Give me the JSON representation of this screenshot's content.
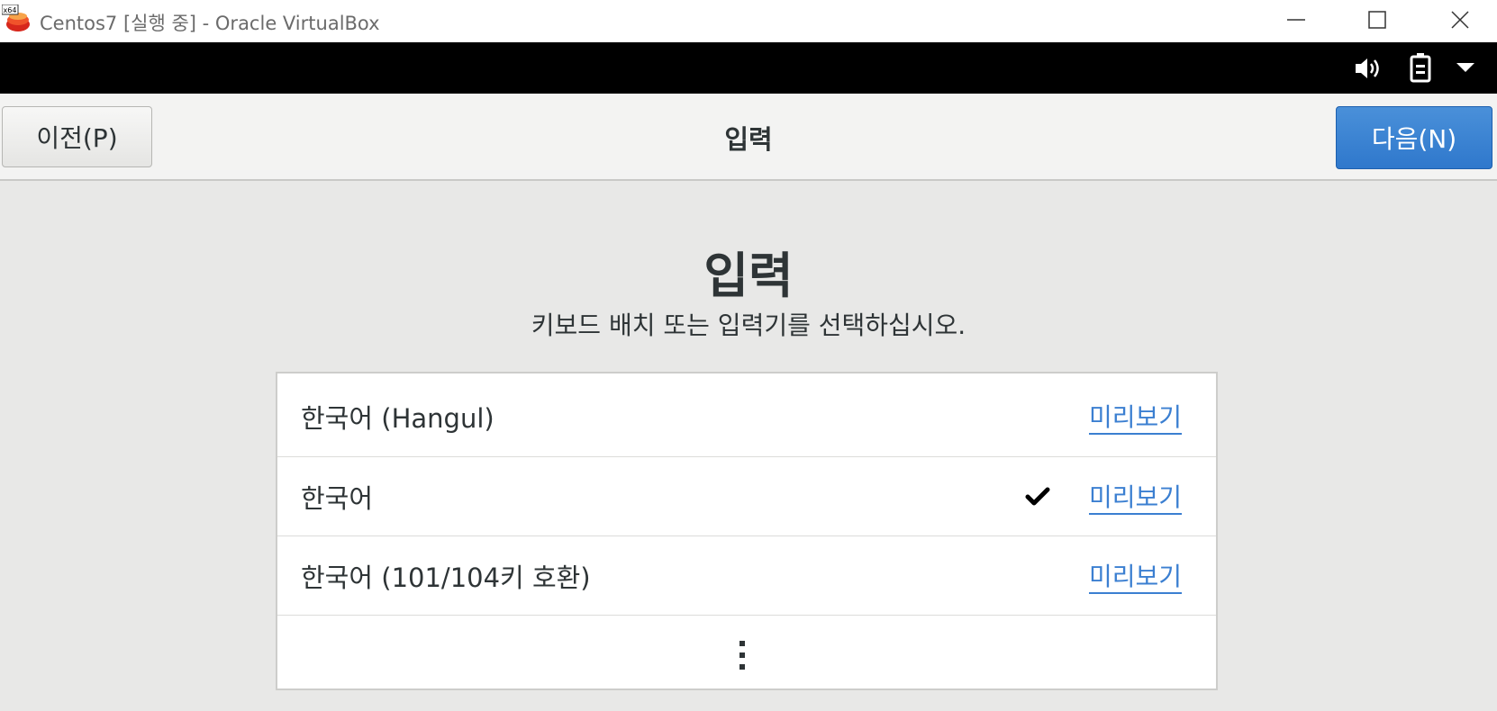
{
  "window": {
    "title": "Centos7 [실행 중] - Oracle VirtualBox",
    "icon": "virtualbox-x64-icon",
    "controls": [
      "minimize-icon",
      "maximize-icon",
      "close-icon"
    ]
  },
  "top_bar": {
    "icons": [
      "volume-icon",
      "battery-icon",
      "dropdown-arrow-icon"
    ]
  },
  "header": {
    "prev_label": "이전(P)",
    "title": "입력",
    "next_label": "다음(N)",
    "next_color": "#3584e4"
  },
  "main": {
    "title": "입력",
    "subtitle": "키보드 배치 또는 입력기를 선택하십시오.",
    "items": [
      {
        "label": "한국어 (Hangul)",
        "selected": false,
        "preview_label": "미리보기"
      },
      {
        "label": "한국어",
        "selected": true,
        "preview_label": "미리보기"
      },
      {
        "label": "한국어 (101/104키 호환)",
        "selected": false,
        "preview_label": "미리보기"
      }
    ],
    "more_icon": "more-vertical-icon",
    "link_color": "#3b7fd1"
  }
}
